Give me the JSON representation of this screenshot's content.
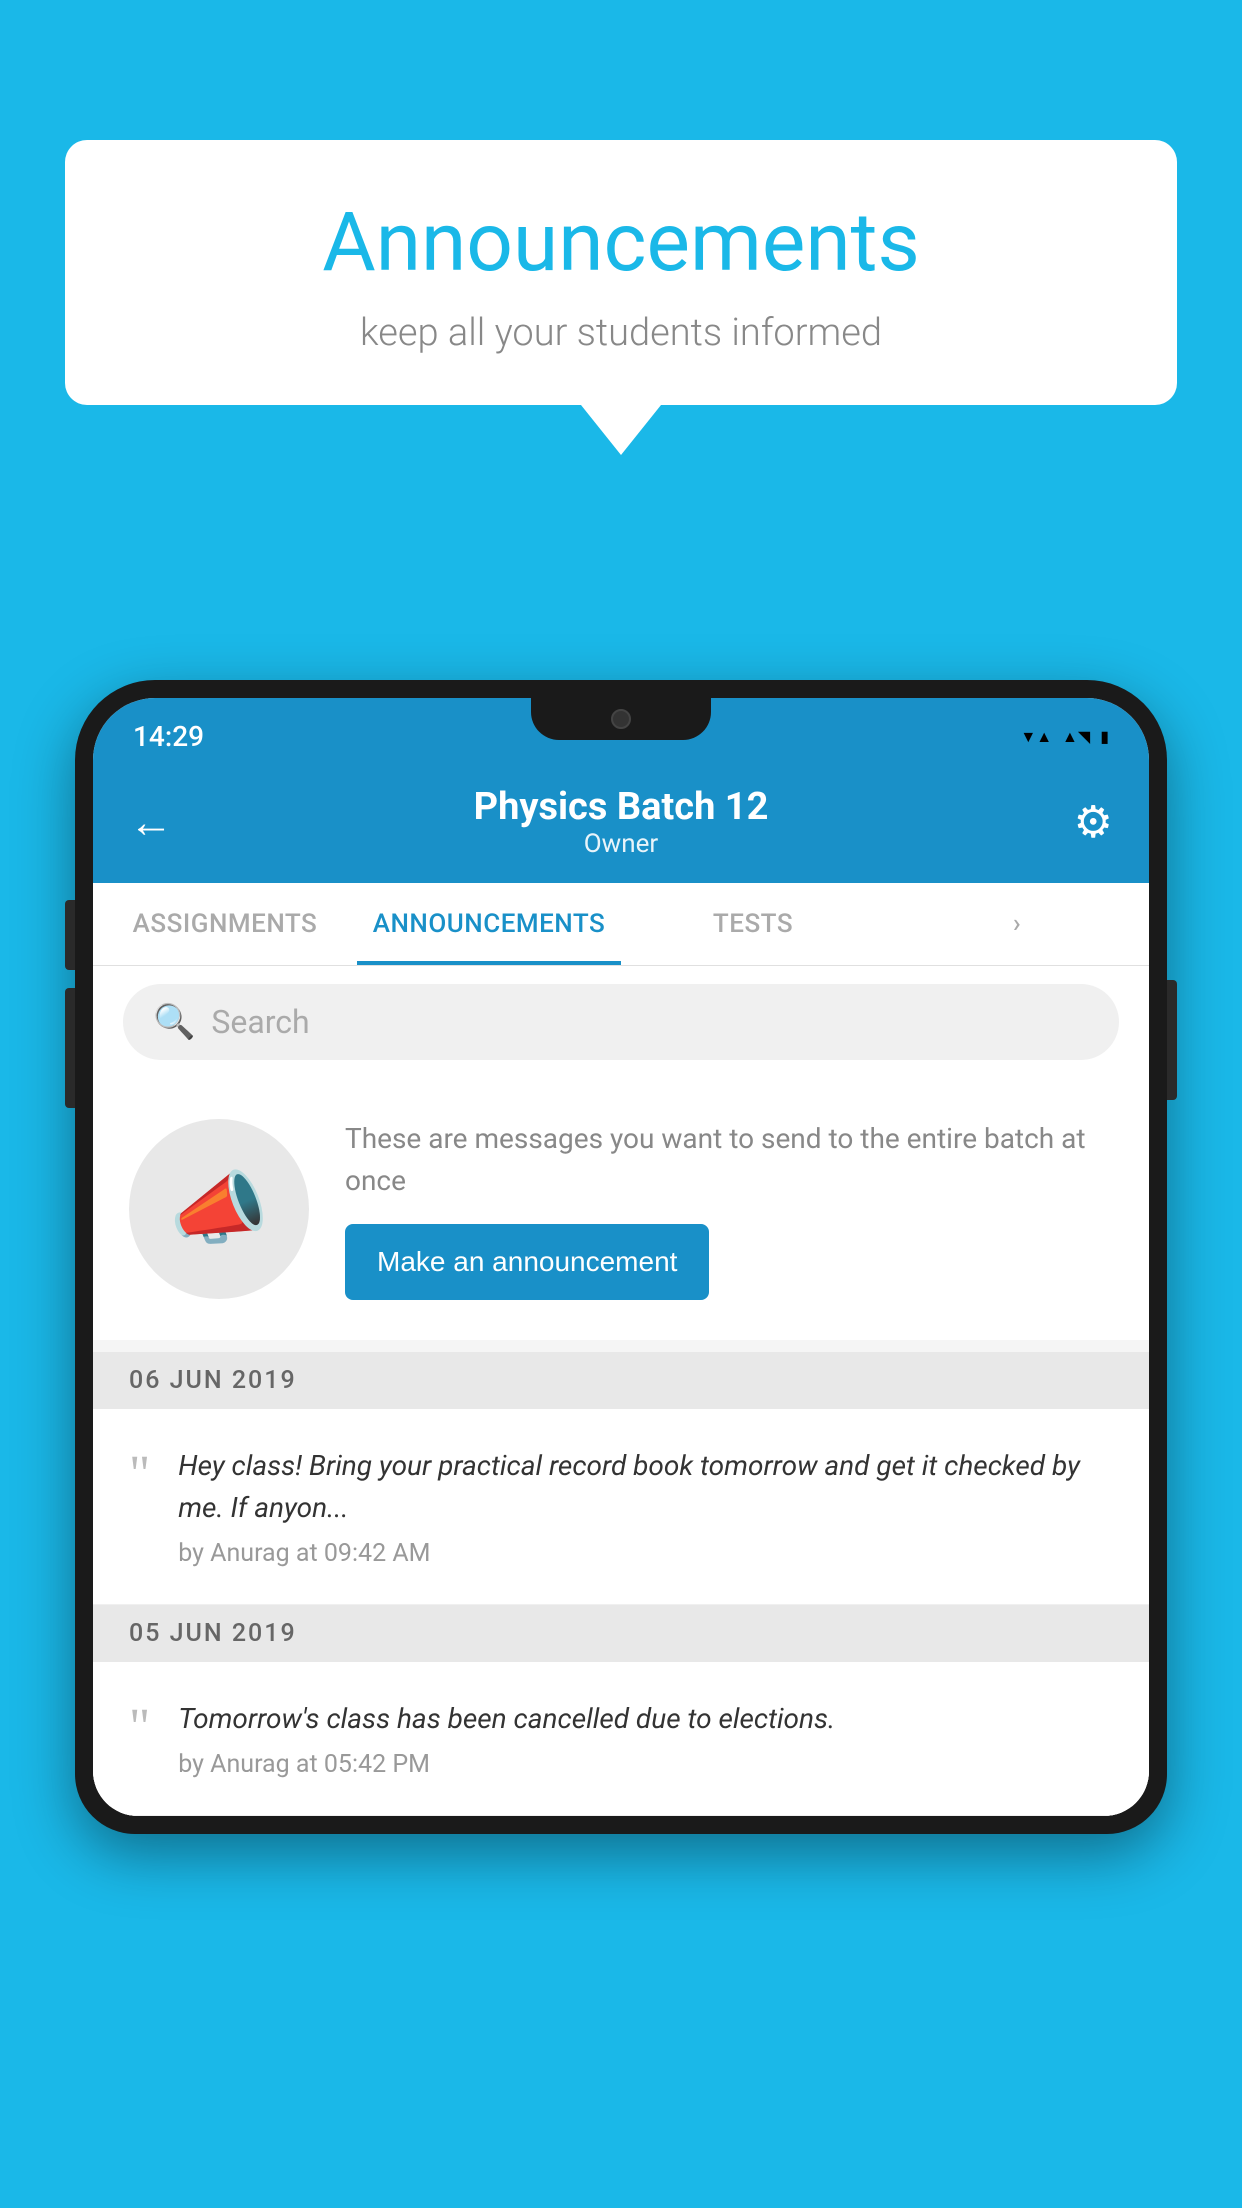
{
  "background_color": "#1ab8e8",
  "speech_bubble": {
    "title": "Announcements",
    "subtitle": "keep all your students informed"
  },
  "status_bar": {
    "time": "14:29",
    "wifi": "▼",
    "signal": "▲",
    "battery": "▮"
  },
  "app_bar": {
    "title": "Physics Batch 12",
    "subtitle": "Owner",
    "back_label": "←",
    "settings_label": "⚙"
  },
  "tabs": [
    {
      "label": "ASSIGNMENTS",
      "active": false
    },
    {
      "label": "ANNOUNCEMENTS",
      "active": true
    },
    {
      "label": "TESTS",
      "active": false
    },
    {
      "label": "›",
      "active": false
    }
  ],
  "search": {
    "placeholder": "Search"
  },
  "empty_state": {
    "description": "These are messages you want to send to the entire batch at once",
    "button_label": "Make an announcement"
  },
  "announcements": [
    {
      "date": "06  JUN  2019",
      "items": [
        {
          "text": "Hey class! Bring your practical record book tomorrow and get it checked by me. If anyon...",
          "author": "by Anurag at 09:42 AM"
        }
      ]
    },
    {
      "date": "05  JUN  2019",
      "items": [
        {
          "text": "Tomorrow's class has been cancelled due to elections.",
          "author": "by Anurag at 05:42 PM"
        }
      ]
    }
  ],
  "icons": {
    "back": "←",
    "settings": "⚙",
    "search": "🔍",
    "quote": "““",
    "megaphone": "📣"
  }
}
